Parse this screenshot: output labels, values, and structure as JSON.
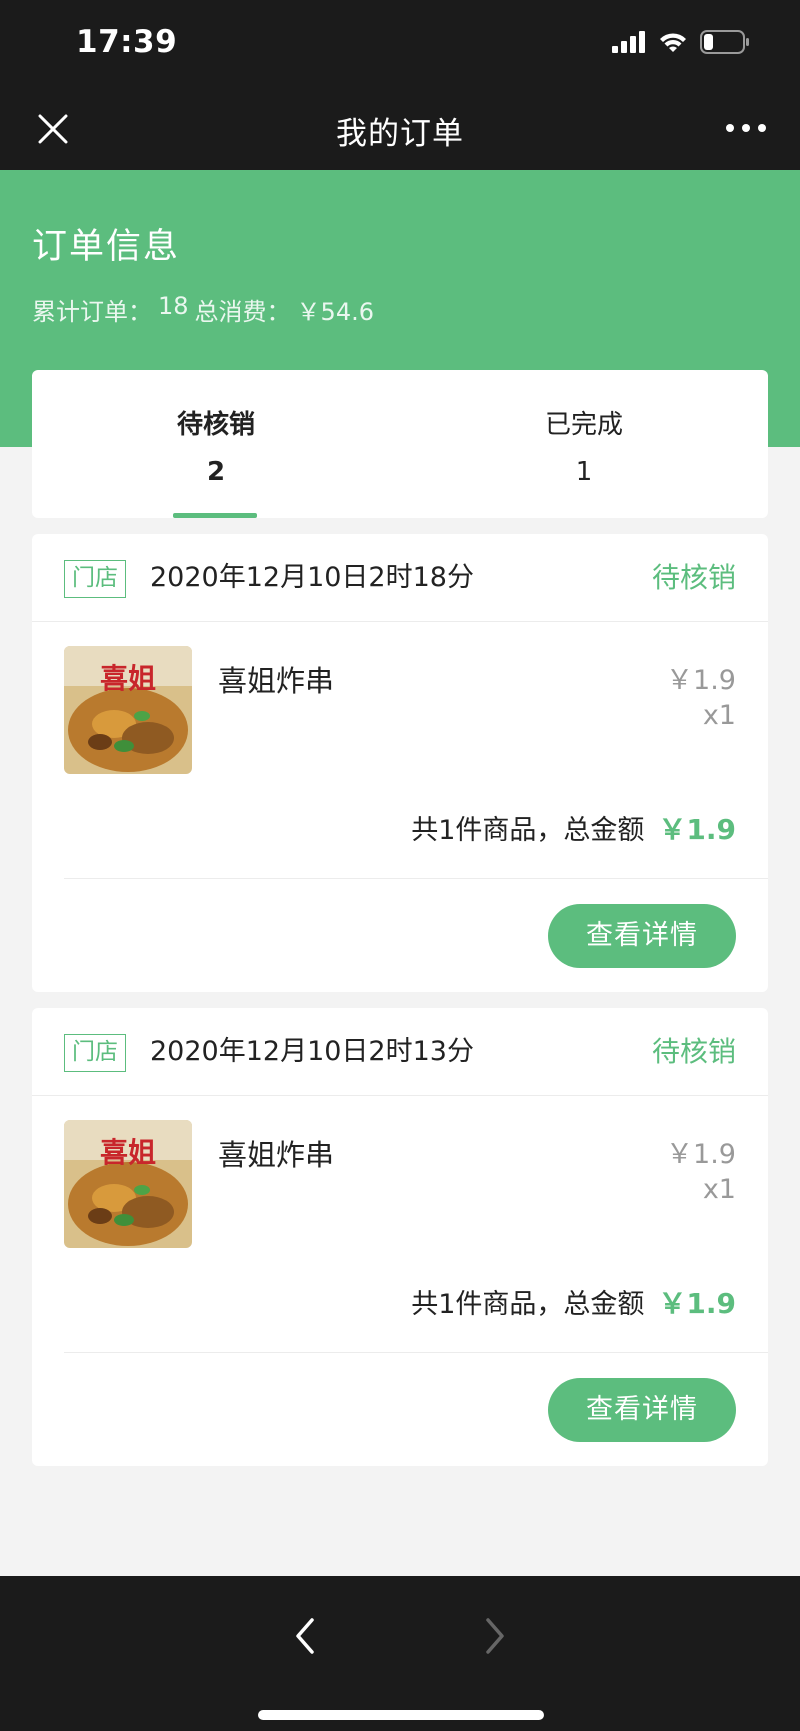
{
  "status_bar": {
    "time": "17:39"
  },
  "nav": {
    "title": "我的订单"
  },
  "banner": {
    "title": "订单信息",
    "orders_label": "累计订单：",
    "orders_count": "18",
    "spend_label": "总消费：",
    "spend_value": "￥54.6"
  },
  "tabs": [
    {
      "label": "待核销",
      "count": "2",
      "active": true
    },
    {
      "label": "已完成",
      "count": "1",
      "active": false
    }
  ],
  "orders": [
    {
      "store_tag": "门店",
      "time": "2020年12月10日2时18分",
      "status": "待核销",
      "item_name": "喜姐炸串",
      "item_price": "￥1.9",
      "item_qty": "x1",
      "summary": "共1件商品，总金额",
      "total": "￥1.9",
      "button": "查看详情",
      "thumb_text": "喜姐"
    },
    {
      "store_tag": "门店",
      "time": "2020年12月10日2时13分",
      "status": "待核销",
      "item_name": "喜姐炸串",
      "item_price": "￥1.9",
      "item_qty": "x1",
      "summary": "共1件商品，总金额",
      "total": "￥1.9",
      "button": "查看详情",
      "thumb_text": "喜姐"
    }
  ],
  "colors": {
    "accent": "#5cbd7e",
    "bar": "#1b1b1b",
    "background": "#f3f3f3"
  },
  "icons": [
    "close-icon",
    "more-icon",
    "signal-icon",
    "wifi-icon",
    "battery-icon",
    "back-arrow-icon",
    "forward-arrow-icon"
  ]
}
